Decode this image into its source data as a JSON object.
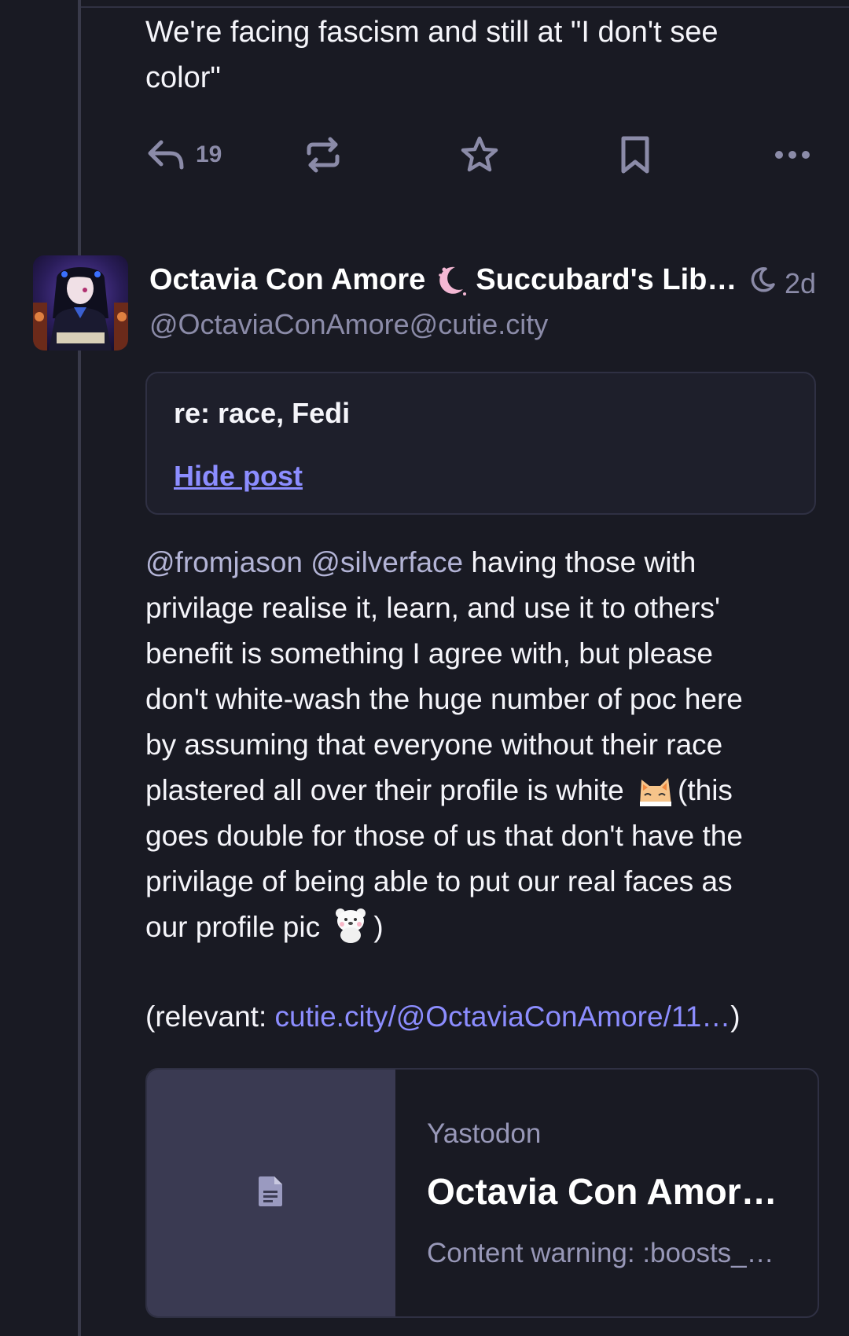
{
  "previous_post": {
    "text_line1": "We're facing fascism and still at \"I don't see",
    "text_line2": "color\"",
    "actions": {
      "reply_count": "19",
      "reply_icon": "reply-icon",
      "boost_icon": "boost-icon",
      "favourite_icon": "star-icon",
      "bookmark_icon": "bookmark-icon",
      "more_icon": "more-icon"
    }
  },
  "post": {
    "display_name": "Octavia Con Amore",
    "display_name_emoji": "moon-emoji",
    "display_name_suffix": "Succubard's Lib…",
    "handle": "@OctaviaConAmore@cutie.city",
    "time_icon": "moon-icon",
    "time_ago": "2d",
    "content_warning": {
      "title": "re: race, Fedi",
      "toggle_label": "Hide post"
    },
    "body": {
      "mention1": "@fromjason",
      "mention2": "@silverface",
      "line1_rest": " having those with",
      "line2": "privilage realise it, learn, and use it to others'",
      "line3": "benefit is something I agree with, but please",
      "line4": "don't white-wash the huge number of poc here",
      "line5": "by assuming that everyone without their race",
      "line6_a": "plastered all over their profile is white ",
      "line6_b": "(this",
      "line7": "goes double for those of us that don't have the",
      "line8": "privilage of being able to put our real faces as",
      "line9_a": "our profile pic ",
      "line9_b": ")"
    },
    "relevant": {
      "prefix": "(relevant: ",
      "link": "cutie.city/@OctaviaConAmore/11…",
      "suffix": ")"
    },
    "card": {
      "provider": "Yastodon",
      "title": "Octavia Con Amor…",
      "description": "Content warning: :boosts_…",
      "thumb_icon": "document-icon"
    }
  },
  "colors": {
    "background": "#191a23",
    "accent": "#8c8dff",
    "muted": "#8b8ba8",
    "text": "#f5f5fa"
  }
}
